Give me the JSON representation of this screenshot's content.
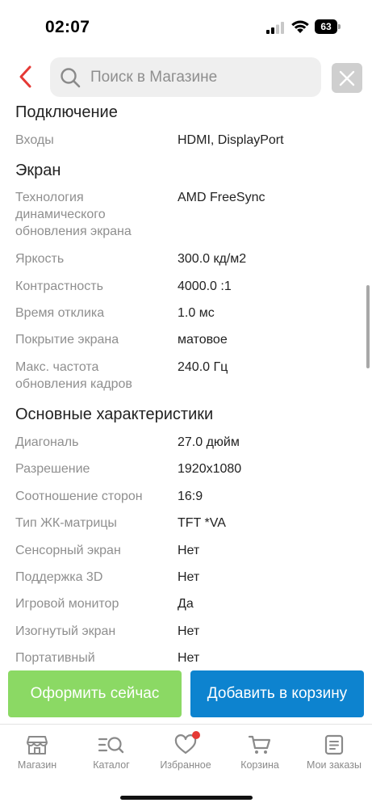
{
  "status_bar": {
    "time": "02:07",
    "battery": "63"
  },
  "search": {
    "placeholder": "Поиск в Магазине"
  },
  "specs": {
    "connection": {
      "title": "Подключение",
      "rows": [
        {
          "label": "Входы",
          "value": "HDMI, DisplayPort"
        }
      ]
    },
    "screen": {
      "title": "Экран",
      "rows": [
        {
          "label": "Технология динамического обновления экрана",
          "value": "AMD FreeSync"
        },
        {
          "label": "Яркость",
          "value": "300.0 кд/м2"
        },
        {
          "label": "Контрастность",
          "value": "4000.0 :1"
        },
        {
          "label": "Время отклика",
          "value": "1.0 мс"
        },
        {
          "label": "Покрытие экрана",
          "value": "матовое"
        },
        {
          "label": "Макс. частота обновления кадров",
          "value": "240.0 Гц"
        }
      ]
    },
    "main": {
      "title": "Основные характеристики",
      "rows": [
        {
          "label": "Диагональ",
          "value": "27.0 дюйм"
        },
        {
          "label": "Разрешение",
          "value": "1920x1080"
        },
        {
          "label": "Соотношение сторон",
          "value": "16:9"
        },
        {
          "label": "Тип ЖК-матрицы",
          "value": "TFT *VA"
        },
        {
          "label": "Сенсорный экран",
          "value": "Нет"
        },
        {
          "label": "Поддержка 3D",
          "value": "Нет"
        },
        {
          "label": "Игровой монитор",
          "value": "Да"
        },
        {
          "label": "Изогнутый экран",
          "value": "Нет"
        },
        {
          "label": "Портативный",
          "value": "Нет"
        }
      ]
    }
  },
  "actions": {
    "checkout": "Оформить сейчас",
    "add_to_cart": "Добавить в корзину"
  },
  "nav": {
    "items": [
      {
        "label": "Магазин",
        "icon": "store-icon"
      },
      {
        "label": "Каталог",
        "icon": "catalog-search-icon"
      },
      {
        "label": "Избранное",
        "icon": "heart-icon"
      },
      {
        "label": "Корзина",
        "icon": "cart-icon"
      },
      {
        "label": "Мои заказы",
        "icon": "orders-icon"
      }
    ]
  },
  "colors": {
    "accent_red": "#e53935",
    "checkout_green": "#8bd964",
    "cart_blue": "#0d83cf",
    "muted_text": "#8f8f8f"
  }
}
